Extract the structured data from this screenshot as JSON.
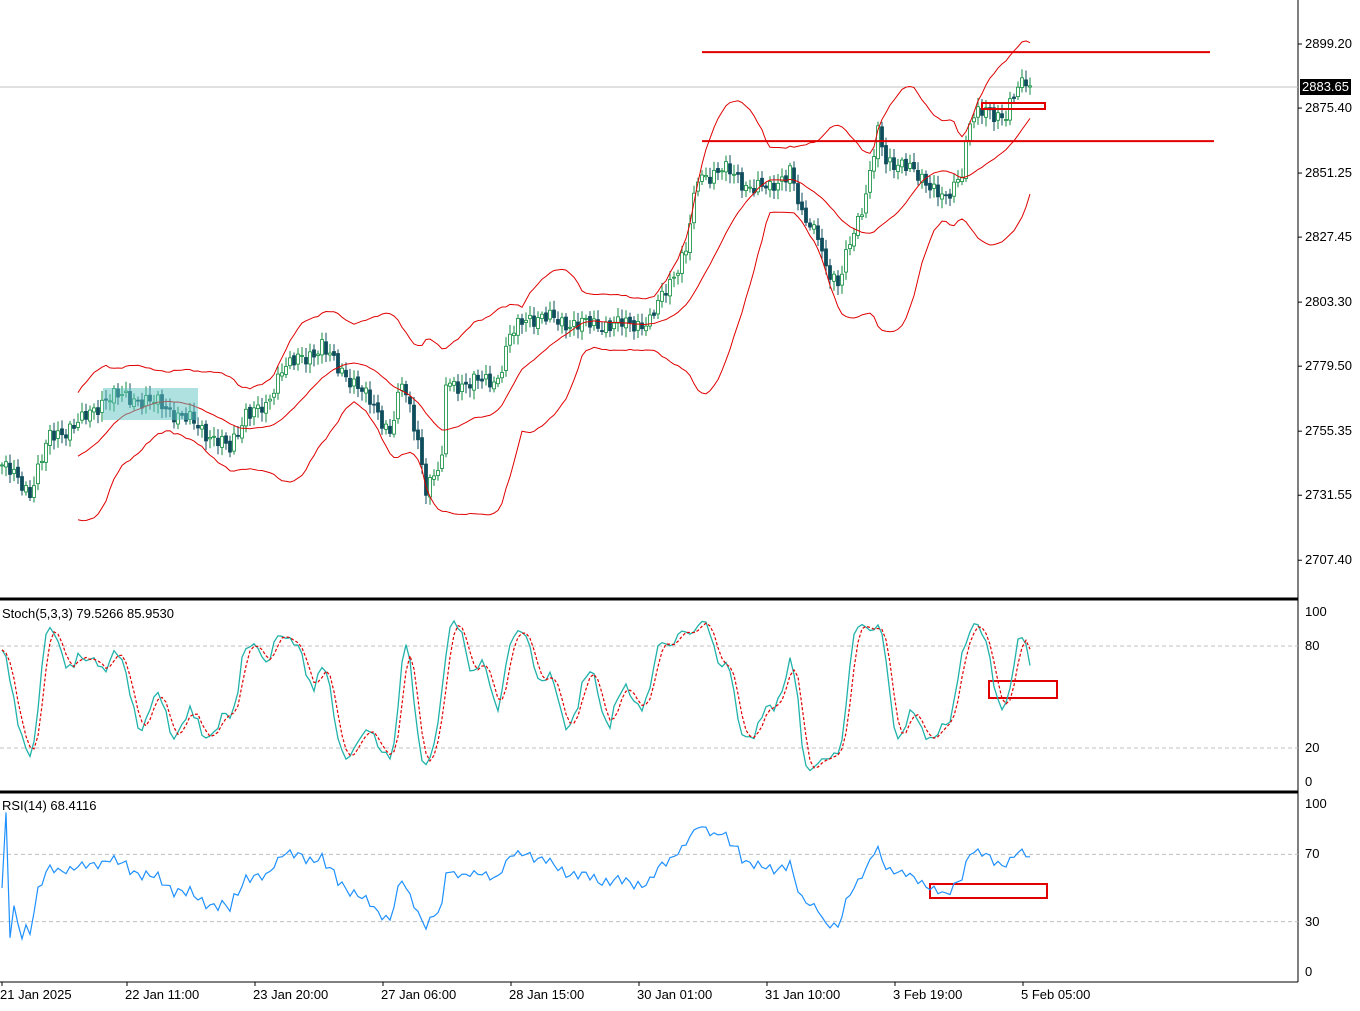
{
  "chart_data": {
    "type": "candlestick",
    "symbol_price_current": "2883.65",
    "price_axis": {
      "ticks": [
        "2899.20",
        "2875.40",
        "2851.25",
        "2827.45",
        "2803.30",
        "2779.50",
        "2755.35",
        "2731.55",
        "2707.40"
      ],
      "range": [
        2707.4,
        2899.2
      ]
    },
    "x_labels": [
      "21 Jan 2025",
      "22 Jan 11:00",
      "23 Jan 20:00",
      "27 Jan 06:00",
      "28 Jan 15:00",
      "30 Jan 01:00",
      "31 Jan 10:00",
      "3 Feb 19:00",
      "5 Feb 05:00"
    ],
    "close_keypoints_bar_price": [
      [
        0,
        2742.8
      ],
      [
        7,
        2733
      ],
      [
        12,
        2753
      ],
      [
        20,
        2759
      ],
      [
        26,
        2768
      ],
      [
        32,
        2768
      ],
      [
        40,
        2765
      ],
      [
        47,
        2759
      ],
      [
        54,
        2752
      ],
      [
        57,
        2748
      ],
      [
        61,
        2763
      ],
      [
        66,
        2763
      ],
      [
        70,
        2780
      ],
      [
        76,
        2782
      ],
      [
        80,
        2788
      ],
      [
        84,
        2778
      ],
      [
        89,
        2773
      ],
      [
        94,
        2761
      ],
      [
        97,
        2756
      ],
      [
        100,
        2773
      ],
      [
        104,
        2752
      ],
      [
        106,
        2735
      ],
      [
        110,
        2742.8
      ],
      [
        111,
        2773
      ],
      [
        117,
        2773
      ],
      [
        124,
        2775
      ],
      [
        127,
        2790
      ],
      [
        131,
        2798
      ],
      [
        137,
        2797
      ],
      [
        144,
        2795
      ],
      [
        150,
        2795
      ],
      [
        156,
        2795
      ],
      [
        162,
        2796
      ],
      [
        166,
        2808
      ],
      [
        171,
        2823
      ],
      [
        174,
        2849
      ],
      [
        180,
        2853
      ],
      [
        186,
        2847
      ],
      [
        192,
        2845
      ],
      [
        197,
        2853
      ],
      [
        200,
        2834
      ],
      [
        204,
        2830
      ],
      [
        206,
        2816
      ],
      [
        209,
        2808
      ],
      [
        212,
        2827
      ],
      [
        216,
        2842
      ],
      [
        219,
        2866
      ],
      [
        221,
        2857
      ],
      [
        226,
        2853
      ],
      [
        231,
        2849
      ],
      [
        236,
        2840
      ],
      [
        240,
        2853
      ],
      [
        242,
        2871
      ],
      [
        246,
        2874
      ],
      [
        251,
        2873
      ],
      [
        254,
        2882
      ],
      [
        256,
        2886
      ],
      [
        257,
        2883.65
      ]
    ],
    "horizontal_levels": [
      2896.2,
      2863.1
    ],
    "bollinger": {
      "period": 20,
      "deviation": 2
    },
    "stochastic": {
      "label": "Stoch(5,3,3) 79.5266 85.9530",
      "levels": [
        100,
        80,
        20,
        0
      ],
      "range": [
        0,
        100
      ]
    },
    "rsi": {
      "label": "RSI(14) 68.4116",
      "levels": [
        100,
        70,
        30,
        0
      ],
      "range": [
        0,
        100
      ]
    }
  },
  "colors": {
    "bull": "#0b8a3a",
    "bear": "#0e4d5c",
    "bands": "#e00000",
    "stoch_main": "#20b2aa",
    "stoch_signal": "#e00000",
    "rsi": "#1e90ff",
    "level": "#e00000"
  }
}
